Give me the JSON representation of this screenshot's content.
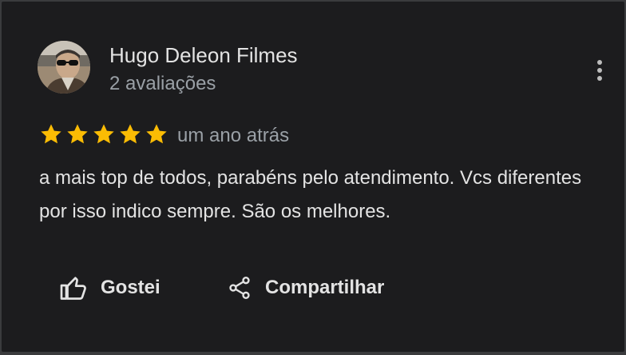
{
  "review": {
    "author_name": "Hugo Deleon Filmes",
    "author_meta": "2 avaliações",
    "rating": 5,
    "rating_max": 5,
    "time": "um ano atrás",
    "text": "a mais top de todos, parabéns pelo atendimento. Vcs diferentes por isso indico sempre. São os melhores."
  },
  "actions": {
    "like_label": "Gostei",
    "share_label": "Compartilhar"
  },
  "icons": {
    "menu": "more-vertical-icon",
    "star": "star-icon",
    "like": "thumb-up-icon",
    "share": "share-icon"
  },
  "colors": {
    "background": "#1c1c1e",
    "star": "#fbbc04",
    "text": "#e3e3e3",
    "secondary_text": "#9aa0a6"
  }
}
